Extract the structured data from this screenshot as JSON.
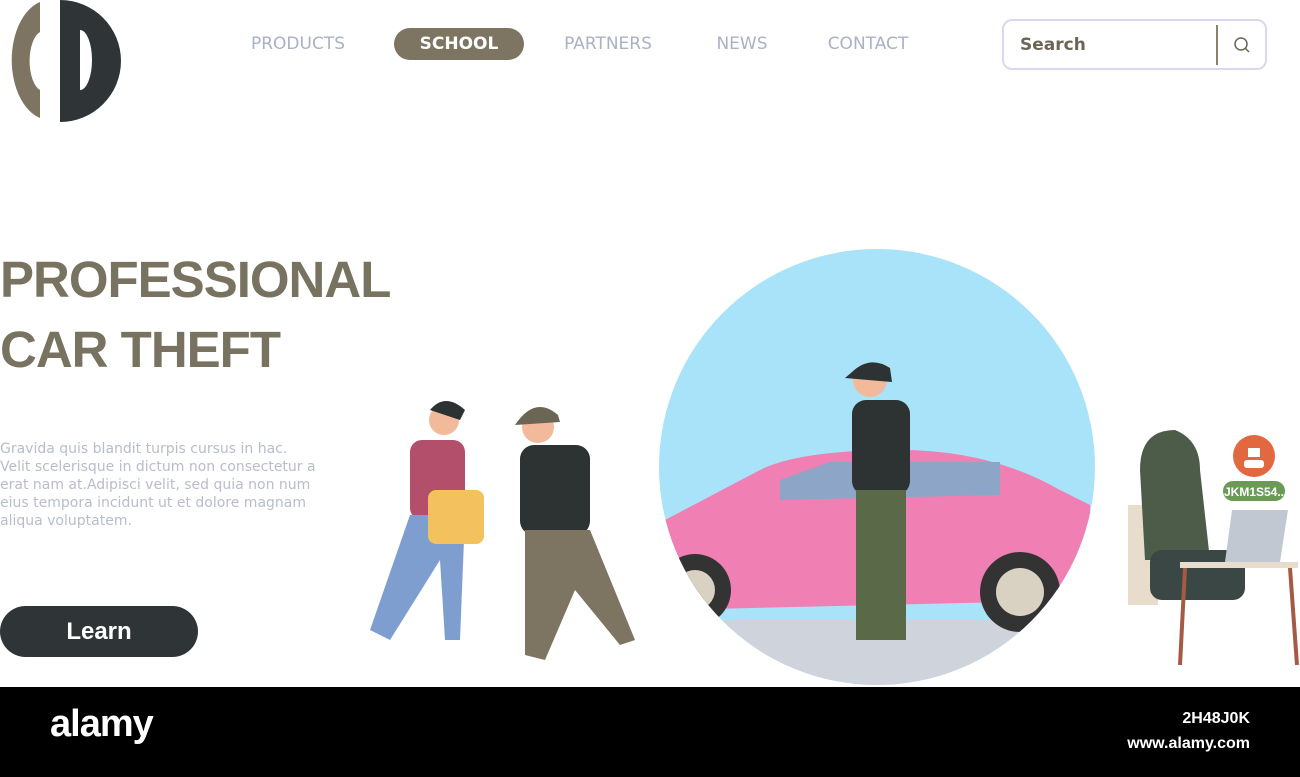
{
  "nav": {
    "items": [
      {
        "label": "PRODUCTS"
      },
      {
        "label": "SCHOOL",
        "active": true
      },
      {
        "label": "PARTNERS"
      },
      {
        "label": "NEWS"
      },
      {
        "label": "CONTACT"
      }
    ]
  },
  "search": {
    "placeholder": "Search",
    "icon": "search-icon"
  },
  "hero": {
    "title_line1": "PROFESSIONAL",
    "title_line2": "CAR THEFT",
    "body": "Gravida quis blandit turpis cursus in hac. Velit scelerisque in dictum non consectetur a erat nam at.Adipisci velit, sed quia non num eius tempora incidunt ut et dolore magnam aliqua voluptatem.",
    "button": "Learn"
  },
  "illustration": {
    "plate_badge": "JKM1S54..",
    "colors": {
      "sky": "#a9e3f9",
      "car": "#f07fb4",
      "badge": "#e2683f",
      "plate": "#6b9a56"
    }
  },
  "watermark": {
    "brand": "alamy",
    "image_id": "2H48J0K",
    "url": "www.alamy.com"
  }
}
